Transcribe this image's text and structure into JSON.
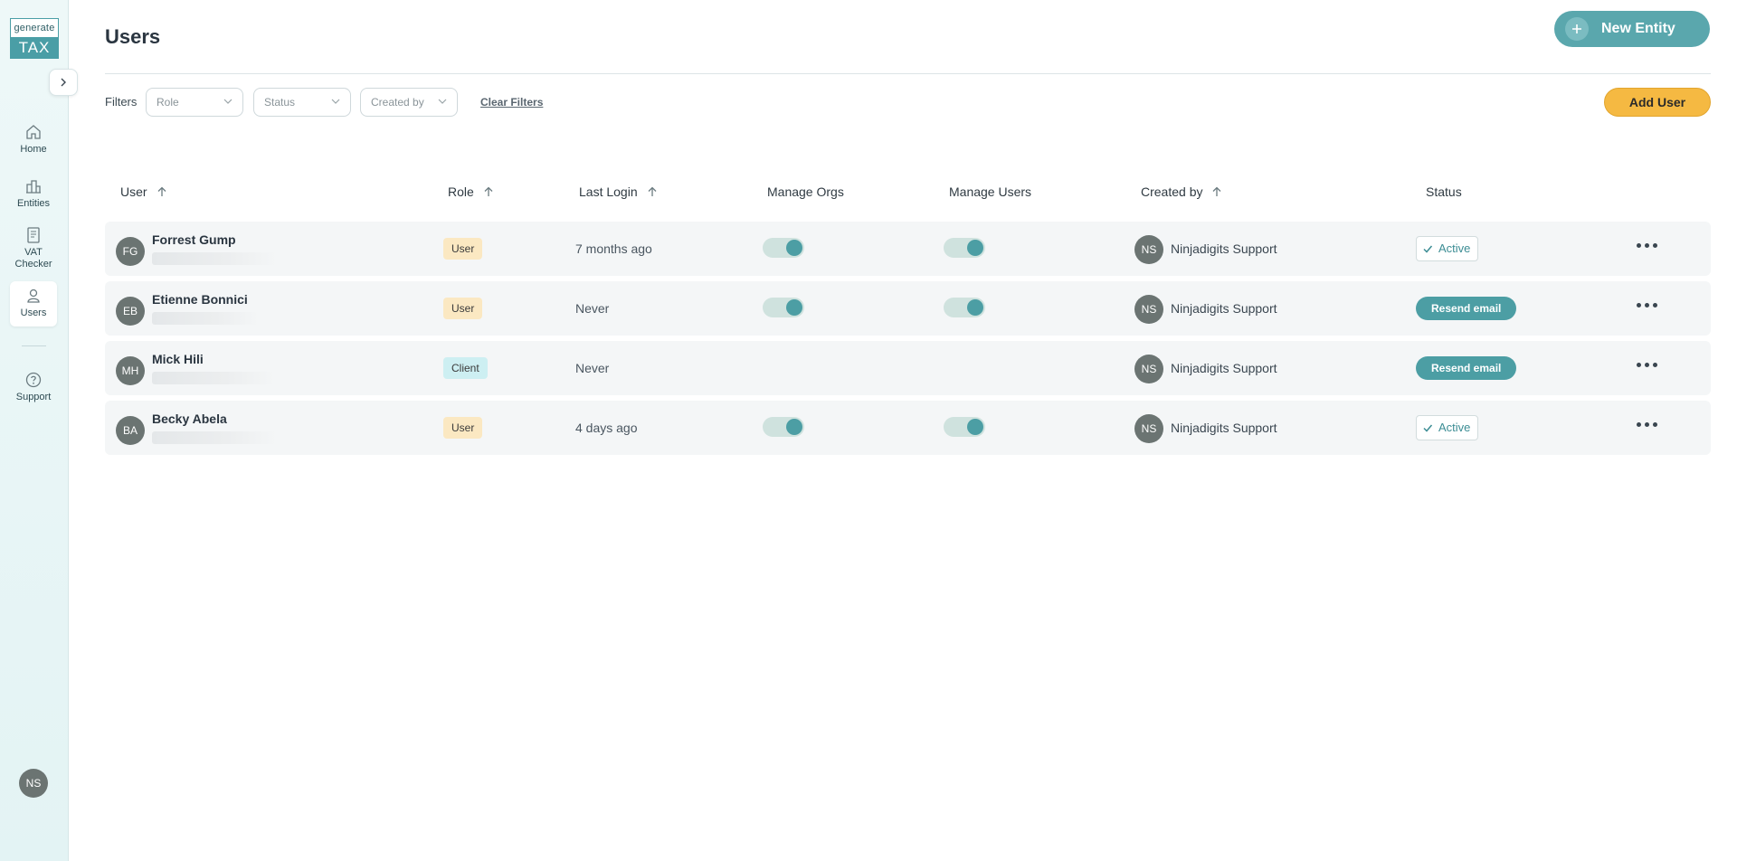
{
  "app": {
    "logo_top": "generate",
    "logo_bottom": "TAX"
  },
  "sidebar": {
    "items": [
      {
        "label": "Home",
        "icon": "home-icon"
      },
      {
        "label": "Entities",
        "icon": "buildings-icon"
      },
      {
        "label": "VAT Checker",
        "icon": "document-icon"
      },
      {
        "label": "Users",
        "icon": "user-icon",
        "active": true
      },
      {
        "label": "Support",
        "icon": "help-circle-icon"
      }
    ],
    "avatar_initials": "NS"
  },
  "header": {
    "title": "Users",
    "new_entity_label": "New Entity"
  },
  "filters": {
    "label": "Filters",
    "role_placeholder": "Role",
    "status_placeholder": "Status",
    "created_by_placeholder": "Created by",
    "clear_label": "Clear Filters",
    "add_user_label": "Add User"
  },
  "table": {
    "columns": [
      "User",
      "Role",
      "Last Login",
      "Manage Orgs",
      "Manage Users",
      "Created by",
      "Status"
    ],
    "rows": [
      {
        "initials": "FG",
        "name": "Forrest Gump",
        "role": "User",
        "last_login": "7 months ago",
        "manage_orgs": true,
        "manage_users": true,
        "created_by_initials": "NS",
        "created_by": "Ninjadigits Support",
        "status": "Active"
      },
      {
        "initials": "EB",
        "name": "Etienne Bonnici",
        "role": "User",
        "last_login": "Never",
        "manage_orgs": true,
        "manage_users": true,
        "created_by_initials": "NS",
        "created_by": "Ninjadigits Support",
        "status": "Resend email"
      },
      {
        "initials": "MH",
        "name": "Mick Hili",
        "role": "Client",
        "last_login": "Never",
        "manage_orgs": false,
        "manage_users": false,
        "created_by_initials": "NS",
        "created_by": "Ninjadigits Support",
        "status": "Resend email"
      },
      {
        "initials": "BA",
        "name": "Becky Abela",
        "role": "User",
        "last_login": "4 days ago",
        "manage_orgs": true,
        "manage_users": true,
        "created_by_initials": "NS",
        "created_by": "Ninjadigits Support",
        "status": "Active"
      }
    ]
  },
  "colors": {
    "accent": "#4c9ea4",
    "add_user": "#f5b942",
    "user_badge": "#fbe8c2",
    "client_badge": "#cdeff2"
  }
}
